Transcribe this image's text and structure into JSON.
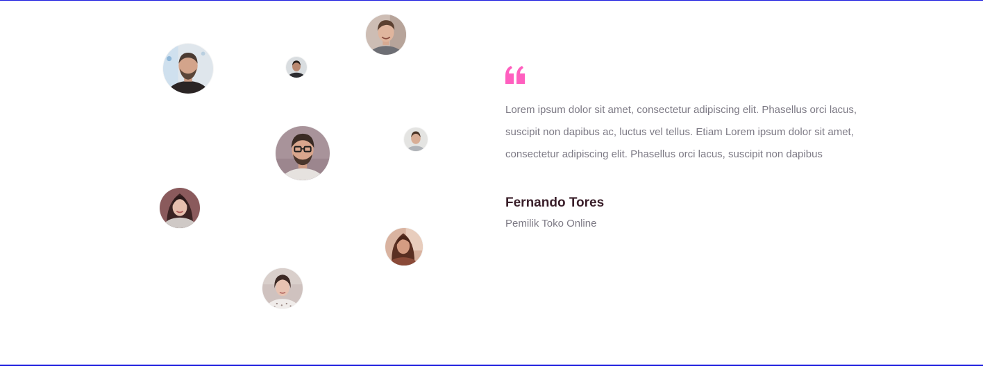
{
  "colors": {
    "accent": "#ff5fbf",
    "frame_border": "#1a1adf",
    "body_text": "#7d7a85",
    "name_text": "#3a1f2a",
    "background": "#ffffff"
  },
  "avatars": [
    {
      "label": "avatar-man-beard"
    },
    {
      "label": "avatar-man-small"
    },
    {
      "label": "avatar-man-smiling"
    },
    {
      "label": "avatar-man-glasses"
    },
    {
      "label": "avatar-man-small-right"
    },
    {
      "label": "avatar-woman-scarf"
    },
    {
      "label": "avatar-woman-sun"
    },
    {
      "label": "avatar-woman-dots"
    }
  ],
  "testimonial": {
    "quote_icon": "quote-icon",
    "text": "Lorem ipsum dolor sit amet, consectetur adipiscing elit. Phasellus orci lacus, suscipit non dapibus ac, luctus vel tellus. Etiam Lorem ipsum dolor sit amet, consectetur adipiscing elit. Phasellus orci lacus, suscipit non dapibus",
    "author_name": "Fernando Tores",
    "author_role": "Pemilik Toko Online"
  }
}
